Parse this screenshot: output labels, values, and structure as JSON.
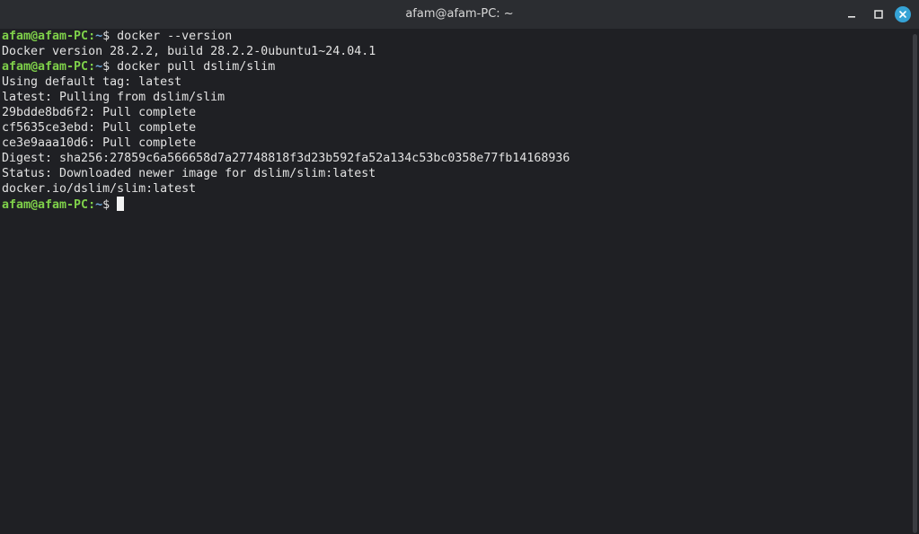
{
  "window": {
    "title": "afam@afam-PC: ~"
  },
  "icons": {
    "minimize": "minimize-icon",
    "maximize": "maximize-icon",
    "close": "close-icon"
  },
  "colors": {
    "prompt_user": "#7fd14a",
    "prompt_path": "#6fa8d8",
    "close_button": "#35a3d6",
    "background": "#1f2024"
  },
  "terminal": {
    "prompt": {
      "user": "afam@afam-PC",
      "colon": ":",
      "path": "~",
      "symbol": "$ "
    },
    "lines": [
      {
        "type": "command",
        "command": "docker --version"
      },
      {
        "type": "output",
        "text": "Docker version 28.2.2, build 28.2.2-0ubuntu1~24.04.1"
      },
      {
        "type": "command",
        "command": "docker pull dslim/slim"
      },
      {
        "type": "output",
        "text": "Using default tag: latest"
      },
      {
        "type": "output",
        "text": "latest: Pulling from dslim/slim"
      },
      {
        "type": "output",
        "text": "29bdde8bd6f2: Pull complete"
      },
      {
        "type": "output",
        "text": "cf5635ce3ebd: Pull complete"
      },
      {
        "type": "output",
        "text": "ce3e9aaa10d6: Pull complete"
      },
      {
        "type": "output",
        "text": "Digest: sha256:27859c6a566658d7a27748818f3d23b592fa52a134c53bc0358e77fb14168936"
      },
      {
        "type": "output",
        "text": "Status: Downloaded newer image for dslim/slim:latest"
      },
      {
        "type": "output",
        "text": "docker.io/dslim/slim:latest"
      },
      {
        "type": "command",
        "command": "",
        "cursor": true
      }
    ]
  }
}
